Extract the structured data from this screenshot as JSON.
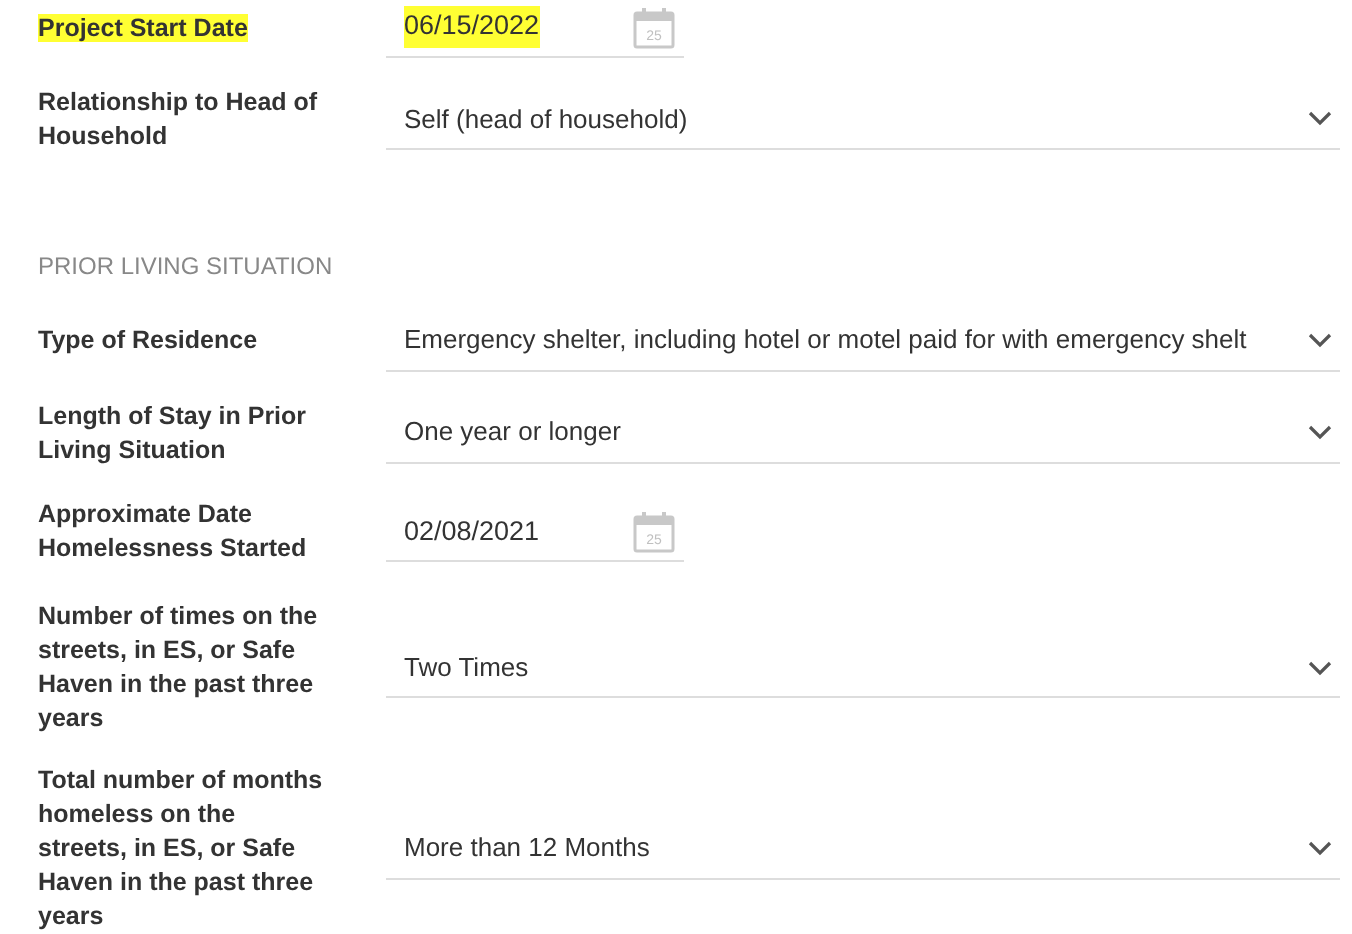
{
  "fields": [
    {
      "kind": "date",
      "label": "Project Start Date",
      "value": "06/15/2022",
      "calendar_day": "25",
      "highlighted": true
    },
    {
      "kind": "select",
      "label": "Relationship to Head of Household",
      "value": "Self (head of household)",
      "highlighted": false
    },
    {
      "kind": "section",
      "label": "PRIOR LIVING SITUATION"
    },
    {
      "kind": "select",
      "label": "Type of Residence",
      "value": "Emergency shelter, including hotel or motel paid for with emergency shelt",
      "highlighted": false
    },
    {
      "kind": "select",
      "label": "Length of Stay in Prior Living Situation",
      "value": "One year or longer",
      "highlighted": false
    },
    {
      "kind": "date",
      "label": "Approximate Date Homelessness Started",
      "value": "02/08/2021",
      "calendar_day": "25",
      "highlighted": false
    },
    {
      "kind": "select",
      "label": "Number of times on the streets, in ES, or Safe Haven in the past three years",
      "value": "Two Times",
      "highlighted": false
    },
    {
      "kind": "select",
      "label": "Total number of months homeless on the streets, in ES, or Safe Haven in the past three years",
      "value": "More than 12 Months",
      "highlighted": false
    }
  ]
}
